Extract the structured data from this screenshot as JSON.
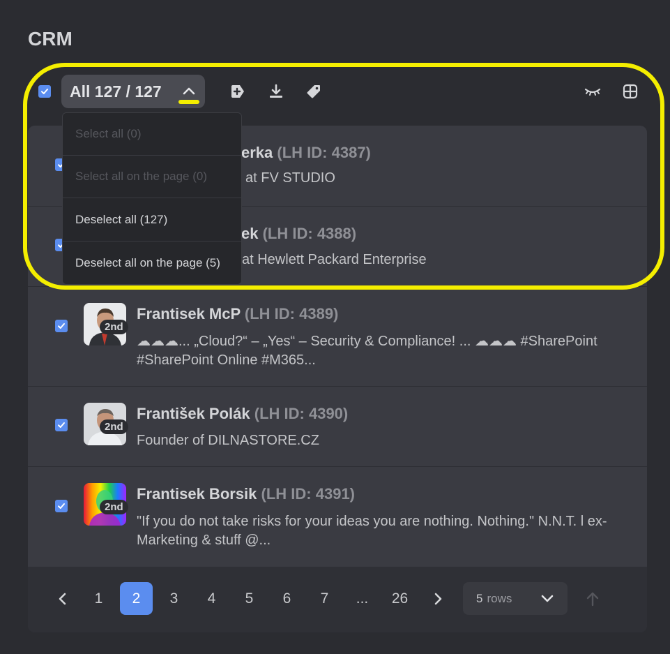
{
  "page": {
    "title": "CRM"
  },
  "toolbar": {
    "select_label": "All 127 / 127",
    "icons": [
      "add-to-campaign-icon",
      "download-icon",
      "tag-icon",
      "hide-icon",
      "grid-icon"
    ]
  },
  "dropdown": {
    "items": [
      {
        "label": "Select all (0)",
        "enabled": false
      },
      {
        "label": "Select all on the page (0)",
        "enabled": false
      },
      {
        "label": "Deselect all (127)",
        "enabled": true
      },
      {
        "label": "Deselect all on the page (5)",
        "enabled": true
      }
    ]
  },
  "rows": [
    {
      "name": "erka",
      "lh_id": "(LH ID: 4387)",
      "headline": "at FV STUDIO",
      "degree": "",
      "checked": true
    },
    {
      "name": "ek",
      "lh_id": "(LH ID: 4388)",
      "headline": "at Hewlett Packard Enterprise",
      "degree": "",
      "checked": true
    },
    {
      "name": "Frantisek McP",
      "lh_id": "(LH ID: 4389)",
      "headline": "☁☁☁... „Cloud?“ – „Yes“ – Security & Compliance! ... ☁☁☁ #SharePoint #SharePoint Online #M365...",
      "degree": "2nd",
      "checked": true
    },
    {
      "name": "František Polák",
      "lh_id": "(LH ID: 4390)",
      "headline": "Founder of DILNASTORE.CZ",
      "degree": "2nd",
      "checked": true
    },
    {
      "name": "Frantisek Borsik",
      "lh_id": "(LH ID: 4391)",
      "headline": "\"If you do not take risks for your ideas you are nothing. Nothing.\" N.N.T. l ex-Marketing & stuff @...",
      "degree": "2nd",
      "checked": true
    }
  ],
  "pagination": {
    "pages": [
      "1",
      "2",
      "3",
      "4",
      "5",
      "6",
      "7",
      "...",
      "26"
    ],
    "current": "2",
    "rows_value": "5",
    "rows_unit": "rows"
  },
  "colors": {
    "accent": "#5b8def",
    "highlight": "#f4ee00",
    "background": "#2b2c31"
  }
}
